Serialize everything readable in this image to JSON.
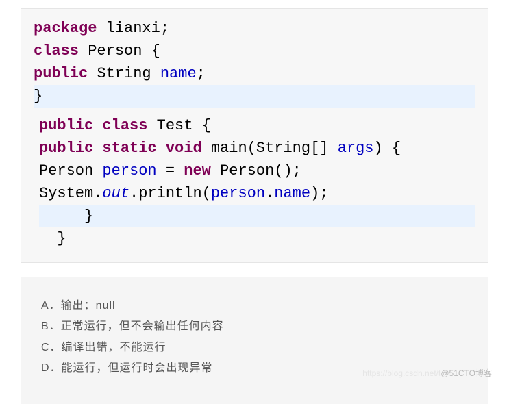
{
  "code": {
    "line1": {
      "kw": "package",
      "sp": " ",
      "id": "lianxi",
      "end": ";"
    },
    "line2": {
      "kw": "class",
      "sp": " ",
      "id": "Person",
      "brace": " {"
    },
    "line3": {
      "kw1": "public",
      "sp1": " ",
      "type": "String",
      "sp2": " ",
      "field": "name",
      "end": ";"
    },
    "line4": {
      "brace": "}"
    },
    "line5": {
      "kw1": "public",
      "sp1": " ",
      "kw2": "class",
      "sp2": " ",
      "id": "Test",
      "brace": " {"
    },
    "line6": {
      "kw1": "public",
      "sp1": " ",
      "kw2": "static",
      "sp2": " ",
      "kw3": "void",
      "sp3": " ",
      "id": "main(String[] ",
      "arg": "args",
      "end": ") {"
    },
    "line7": {
      "type": "Person",
      "sp1": " ",
      "var": "person",
      "mid": " = ",
      "kw": "new",
      "sp2": " ",
      "call": "Person();"
    },
    "line8": {
      "pre": "System.",
      "out": "out",
      "mid": ".println(",
      "var": "person",
      "dot": ".",
      "field": "name",
      "end": ");"
    },
    "line9": {
      "brace": "     }"
    },
    "line10": {
      "brace": "  }"
    }
  },
  "answers": {
    "a": "A．输出：null",
    "b": "B．正常运行，但不会输出任何内容",
    "c": "C．编译出错，不能运行",
    "d": "D．能运行，但运行时会出现异常"
  },
  "watermark": {
    "wm1": "https://blog.csdn.net/t",
    "wm2": "@51CTO博客"
  }
}
